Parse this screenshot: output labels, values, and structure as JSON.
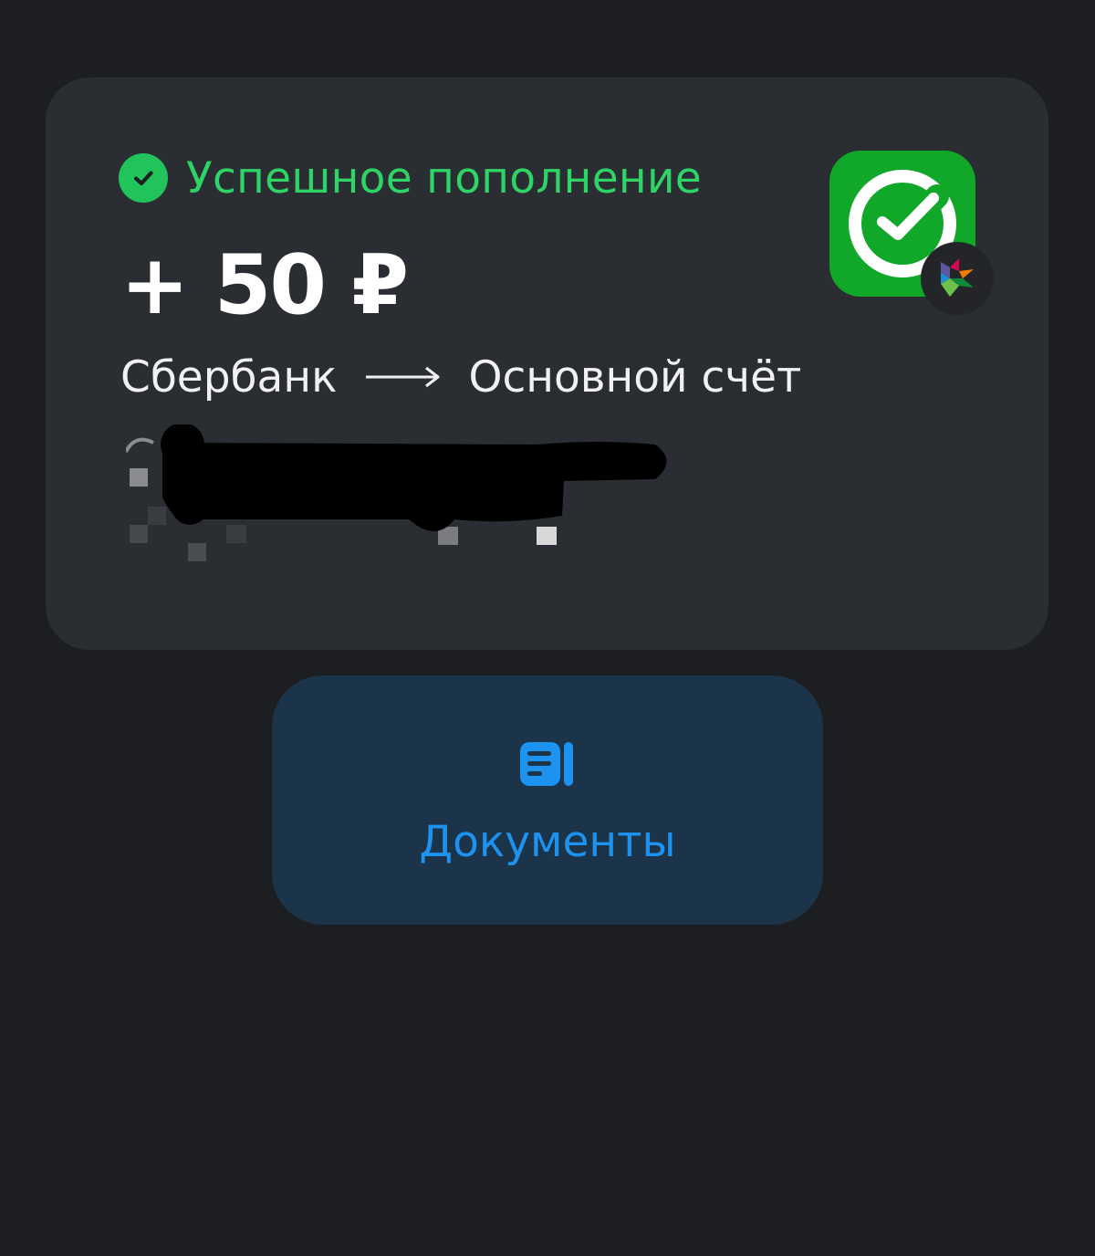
{
  "operation": {
    "status_text": "Успешное пополнение",
    "amount": "+ 50 ₽",
    "source": "Сбербанк",
    "destination": "Основной счёт",
    "status_icon": "check-circle-icon",
    "bank_logo_icon": "sberbank-logo-icon",
    "badge_icon": "sbp-logo-icon"
  },
  "actions": {
    "documents_label": "Документы",
    "documents_icon": "documents-icon"
  },
  "colors": {
    "background": "#1c1e22",
    "card": "#2a2d32",
    "success": "#2fd466",
    "accent": "#1d92ee",
    "button_bg": "#1b344a",
    "sber_green": "#11a82a"
  }
}
